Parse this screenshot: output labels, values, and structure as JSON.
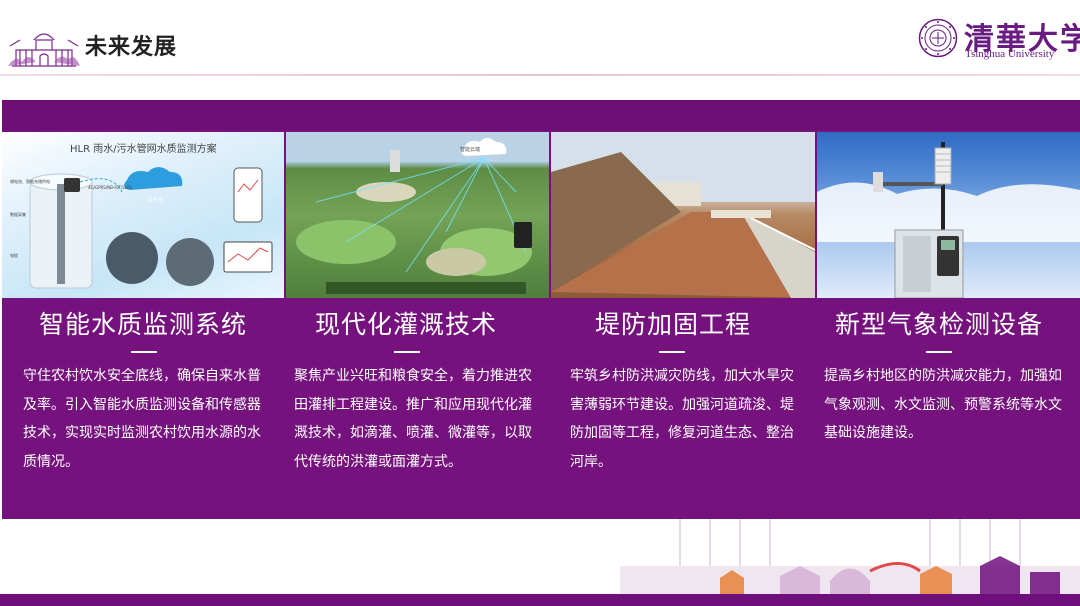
{
  "header": {
    "title": "未来发展",
    "university_cn": "清華大学",
    "university_en": "Tsinghua University"
  },
  "cards": [
    {
      "title": "智能水质监测系统",
      "body": "守住农村饮水安全底线，确保自来水普及率。引入智能水质监测设备和传感器技术，实现实时监测农村饮用水源的水质情况。",
      "image": {
        "caption": "HLR 雨水/污水管网水质监测方案",
        "labels": [
          "增电池、智能充储供电",
          "4G/GPRS/NB-IOT/LoRa",
          "云平台",
          "数据采集",
          "电缆"
        ]
      }
    },
    {
      "title": "现代化灌溉技术",
      "body": "聚焦产业兴旺和粮食安全，着力推进农田灌排工程建设。推广和应用现代化灌溉技术，如滴灌、喷灌、微灌等，以取代传统的洪灌或面灌方式。",
      "image": {
        "caption": "智能云端"
      }
    },
    {
      "title": "堤防加固工程",
      "body": "牢筑乡村防洪减灾防线，加大水旱灾害薄弱环节建设。加强河道疏浚、堤防加固等工程，修复河道生态、整治河岸。",
      "image": {}
    },
    {
      "title": "新型气象检测设备",
      "body": "提高乡村地区的防洪减灾能力，加强如气象观测、水文监测、预警系统等水文基础设施建设。",
      "image": {}
    }
  ],
  "colors": {
    "panel": "#75127d",
    "brand_purple": "#6a1b82",
    "bottom_bar": "#6e0f7c"
  }
}
